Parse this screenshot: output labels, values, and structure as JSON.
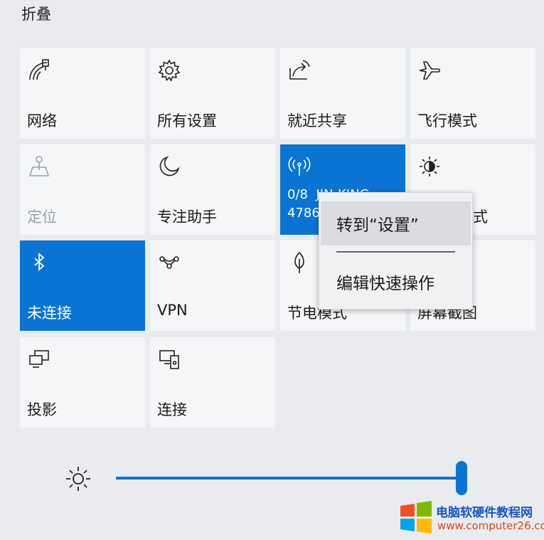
{
  "header": {
    "collapse_label": "折叠"
  },
  "tiles": [
    {
      "label": "网络",
      "icon": "network-icon"
    },
    {
      "label": "所有设置",
      "icon": "gear-icon"
    },
    {
      "label": "就近共享",
      "icon": "share-icon"
    },
    {
      "label": "飞行模式",
      "icon": "airplane-icon"
    },
    {
      "label": "定位",
      "icon": "location-icon",
      "state": "disabled"
    },
    {
      "label": "专注助手",
      "icon": "moon-icon"
    },
    {
      "label": "",
      "icon": "hotspot-icon",
      "state": "active"
    },
    {
      "label": "式",
      "icon": "night-light-icon"
    },
    {
      "label": "未连接",
      "icon": "bluetooth-icon",
      "state": "active"
    },
    {
      "label": "VPN",
      "icon": "vpn-icon"
    },
    {
      "label": "节电模式",
      "icon": "leaf-icon"
    },
    {
      "label": "屏幕截图",
      "icon": "screenshot-icon"
    },
    {
      "label": "投影",
      "icon": "project-icon"
    },
    {
      "label": "连接",
      "icon": "connect-icon"
    }
  ],
  "hotspot": {
    "line1": "0/8",
    "line1_obscured": "JIN-KING",
    "line2": "4786"
  },
  "context_menu": {
    "items": [
      "转到“设置”",
      "编辑快速操作"
    ]
  },
  "brightness": {
    "icon": "brightness-icon",
    "level": 1.0
  },
  "watermark": {
    "line1": "电脑软硬件教程网",
    "line2": "www.computer26.com"
  },
  "colors": {
    "accent": "#0a74d5",
    "tile_bg": "#f5f6f7",
    "page_bg": "#e9ebee"
  }
}
